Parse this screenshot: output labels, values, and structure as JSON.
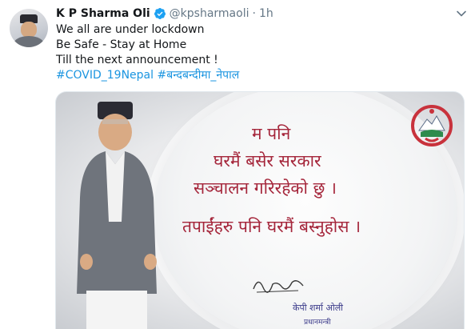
{
  "tweet": {
    "author_name": "K P Sharma Oli",
    "handle": "@kpsharmaoli",
    "separator": "·",
    "time": "1h",
    "lines": [
      "We all are under lockdown",
      "Be Safe - Stay at Home",
      "Till the next announcement !"
    ],
    "hashtags": [
      "#COVID_19Nepal",
      "#बन्दबन्दीमा_नेपाल"
    ]
  },
  "image": {
    "message": [
      "म पनि",
      "घरमैं बसेर सरकार",
      "सञ्चालन गरिरहेको छु ।",
      "तपाईंहरु पनि घरमैं बस्नुहोस ।"
    ],
    "signature_name": "केपी शर्मा ओली",
    "signature_title": "प्रधानमन्त्री"
  },
  "colors": {
    "link": "#1b95e0",
    "verified": "#1da1f2",
    "message": "#a5263b"
  },
  "icons": {
    "verified": "verified-badge-icon",
    "menu": "chevron-down-icon"
  }
}
